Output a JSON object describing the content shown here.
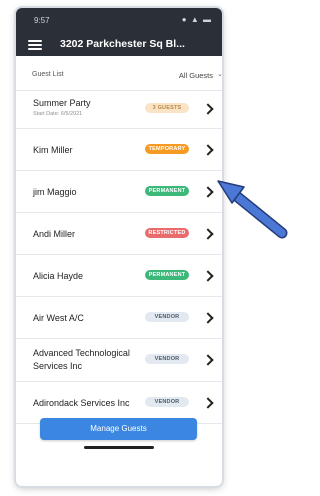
{
  "status": {
    "time": "9:57",
    "icons": "● ▲ ▬"
  },
  "header": {
    "title": "3202 Parkchester Sq Bl..."
  },
  "filter": {
    "label": "Guest List",
    "value": "All Guests"
  },
  "rows": [
    {
      "name": "Summer Party",
      "sub": "Start Date: 6/5/2021",
      "badge": "3 GUESTS",
      "badge_color": "#fbe4c6",
      "badge_text_color": "#b8874a"
    },
    {
      "name": "Kim Miller",
      "badge": "TEMPORARY",
      "badge_color": "#f59a23"
    },
    {
      "name": "jim Maggio",
      "badge": "PERMANENT",
      "badge_color": "#3cb878"
    },
    {
      "name": "Andi Miller",
      "badge": "RESTRICTED",
      "badge_color": "#ea6b6b"
    },
    {
      "name": "Alicia Hayde",
      "badge": "PERMANENT",
      "badge_color": "#3cb878"
    },
    {
      "name": "Air West A/C",
      "badge": "VENDOR",
      "badge_color": "#e3e9f0",
      "badge_text_color": "#4a5a6a"
    },
    {
      "name_line1": "Advanced Technological",
      "name_line2": "Services Inc",
      "badge": "VENDOR",
      "badge_color": "#e3e9f0",
      "badge_text_color": "#4a5a6a"
    },
    {
      "name": "Adirondack Services Inc",
      "badge": "VENDOR",
      "badge_color": "#e3e9f0",
      "badge_text_color": "#4a5a6a"
    }
  ],
  "button": {
    "label": "Manage Guests"
  },
  "accent": "#3a86e0",
  "annotation_arrow_color": "#3f6fd1"
}
